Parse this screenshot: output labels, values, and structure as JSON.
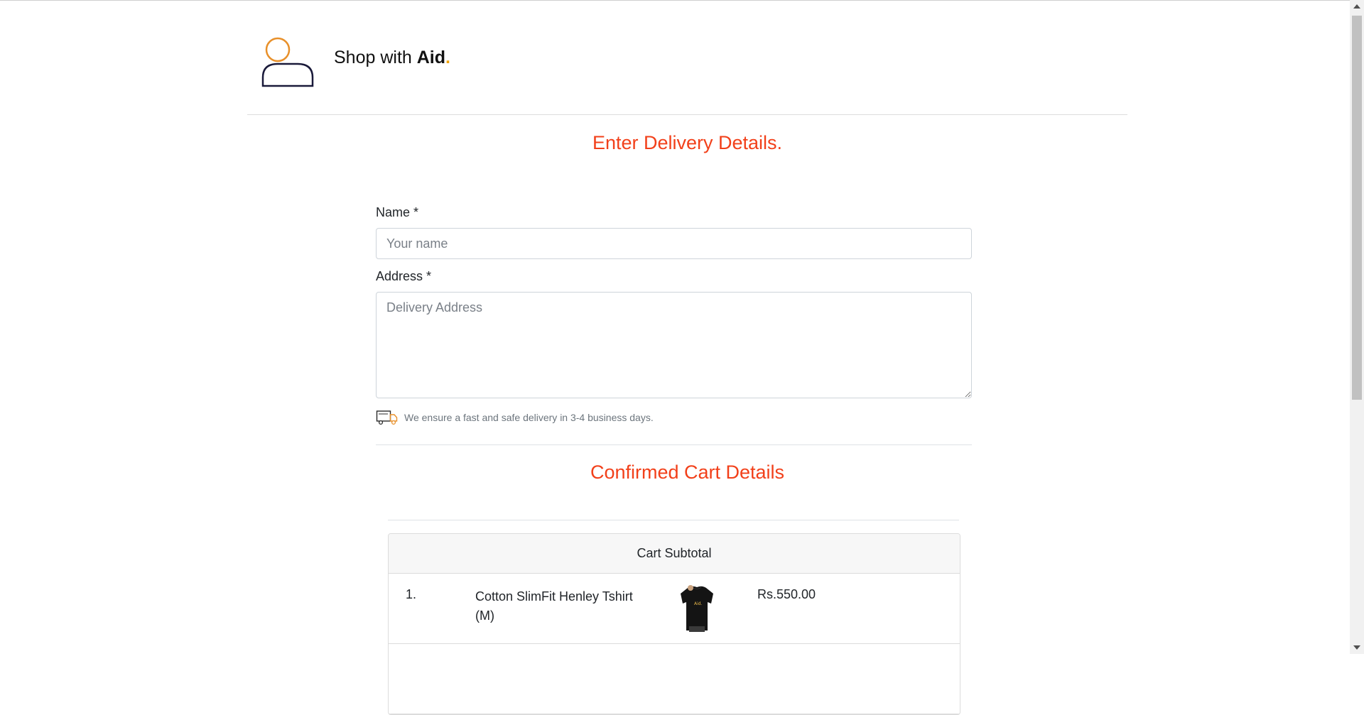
{
  "brand": {
    "prefix": "Shop with ",
    "bold": "Aid",
    "dot": "."
  },
  "delivery": {
    "title": "Enter Delivery Details.",
    "name_label": "Name *",
    "name_placeholder": "Your name",
    "address_label": "Address *",
    "address_placeholder": "Delivery Address",
    "note": "We ensure a fast and safe delivery in 3-4 business days."
  },
  "cart": {
    "title": "Confirmed Cart Details",
    "header": "Cart Subtotal",
    "items": [
      {
        "index": "1.",
        "name": "Cotton SlimFit Henley Tshirt (M)",
        "price": "Rs.550.00"
      }
    ]
  },
  "colors": {
    "accent": "#f2401a",
    "brand_dot": "#f0a30a",
    "logo_head": "#e8902a",
    "logo_body": "#1a1a3a"
  },
  "icons": {
    "logo": "user-avatar-icon",
    "delivery": "delivery-truck-icon",
    "thumb": "tshirt-image"
  }
}
